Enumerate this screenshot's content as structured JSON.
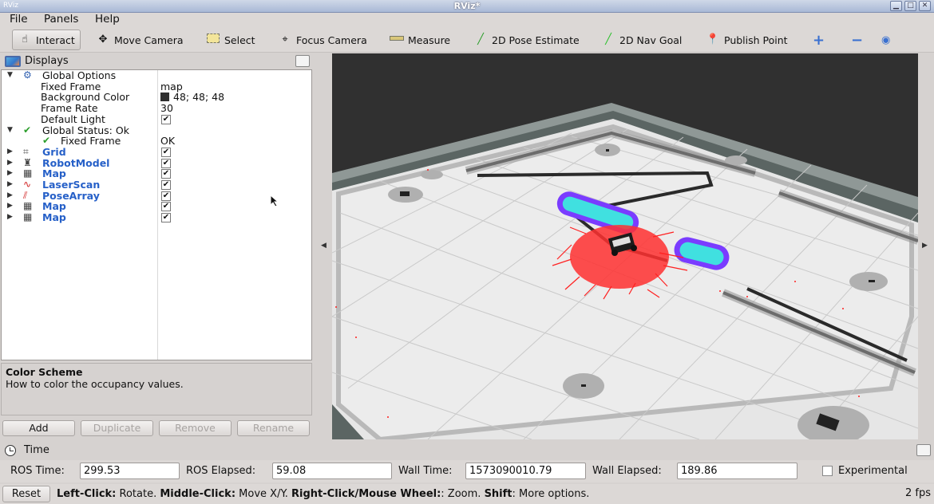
{
  "window": {
    "title": "RViz*",
    "app_icon": "RViz"
  },
  "menu": [
    "File",
    "Panels",
    "Help"
  ],
  "toolbar": {
    "interact": "Interact",
    "move_camera": "Move Camera",
    "select": "Select",
    "focus_camera": "Focus Camera",
    "measure": "Measure",
    "pose_estimate": "2D Pose Estimate",
    "nav_goal": "2D Nav Goal",
    "publish_point": "Publish Point"
  },
  "displays": {
    "title": "Displays",
    "global_options": {
      "label": "Global Options",
      "fixed_frame": {
        "label": "Fixed Frame",
        "value": "map"
      },
      "background_color": {
        "label": "Background Color",
        "value": "48; 48; 48"
      },
      "frame_rate": {
        "label": "Frame Rate",
        "value": "30"
      },
      "default_light": {
        "label": "Default Light",
        "checked": true
      }
    },
    "global_status": {
      "label": "Global Status: Ok",
      "fixed_frame": {
        "label": "Fixed Frame",
        "value": "OK"
      }
    },
    "items": [
      {
        "label": "Grid",
        "icon": "grid-icon",
        "checked": true
      },
      {
        "label": "RobotModel",
        "icon": "robot-model-icon",
        "checked": true
      },
      {
        "label": "Map",
        "icon": "map-icon",
        "checked": true
      },
      {
        "label": "LaserScan",
        "icon": "laser-scan-icon",
        "checked": true
      },
      {
        "label": "PoseArray",
        "icon": "pose-array-icon",
        "checked": true
      },
      {
        "label": "Map",
        "icon": "map-icon",
        "checked": true
      },
      {
        "label": "Map",
        "icon": "map-icon",
        "checked": true
      }
    ]
  },
  "description": {
    "title": "Color Scheme",
    "text": "How to color the occupancy values."
  },
  "panel_buttons": {
    "add": "Add",
    "duplicate": "Duplicate",
    "remove": "Remove",
    "rename": "Rename"
  },
  "time": {
    "title": "Time",
    "ros_time_label": "ROS Time:",
    "ros_time": "299.53",
    "ros_elapsed_label": "ROS Elapsed:",
    "ros_elapsed": "59.08",
    "wall_time_label": "Wall Time:",
    "wall_time": "1573090010.79",
    "wall_elapsed_label": "Wall Elapsed:",
    "wall_elapsed": "189.86",
    "experimental_label": "Experimental"
  },
  "status": {
    "reset": "Reset",
    "left_click": "Left-Click:",
    "left_click_action": " Rotate. ",
    "middle_click": "Middle-Click:",
    "middle_click_action": " Move X/Y. ",
    "right_click": "Right-Click/Mouse Wheel:",
    "right_click_action": ": Zoom. ",
    "shift": "Shift",
    "shift_action": ": More options.",
    "fps": "2 fps"
  },
  "colors": {
    "viewport_bg": "#303030",
    "tree_blue": "#2660c8",
    "particles": "#ff2020",
    "costmap_cyan": "#40e0e0",
    "costmap_purple": "#7a3cff"
  }
}
